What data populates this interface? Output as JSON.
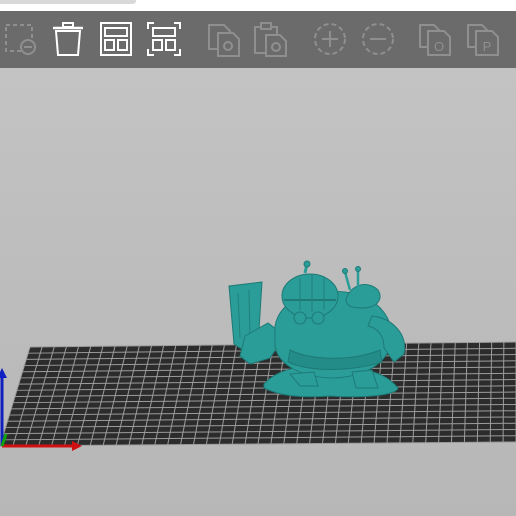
{
  "toolbar": {
    "buttons": [
      {
        "name": "delete-icon",
        "enabled": false
      },
      {
        "name": "delete-all-icon",
        "enabled": true
      },
      {
        "name": "arrange-icon",
        "enabled": true
      },
      {
        "name": "arrange-selection-icon",
        "enabled": true
      },
      {
        "name": "copy-icon",
        "enabled": false
      },
      {
        "name": "paste-icon",
        "enabled": false
      },
      {
        "name": "add-instance-icon",
        "enabled": false
      },
      {
        "name": "remove-instance-icon",
        "enabled": false
      },
      {
        "name": "split-to-objects-icon",
        "enabled": false
      },
      {
        "name": "split-to-parts-icon",
        "enabled": false
      }
    ],
    "split_objects_glyph": "O",
    "split_parts_glyph": "P"
  },
  "colors": {
    "toolbar_bg": "#6b6b6b",
    "icon_enabled": "#ffffff",
    "icon_disabled": "#8f8f8f",
    "bed_grid": "#2a2a2a",
    "bed_lines": "#9a9a9a",
    "model": "#2a9d98",
    "axis_x": "#d01010",
    "axis_y": "#10a010",
    "axis_z": "#1020c0"
  },
  "scene": {
    "model_name": "goblin-warrior-model"
  }
}
